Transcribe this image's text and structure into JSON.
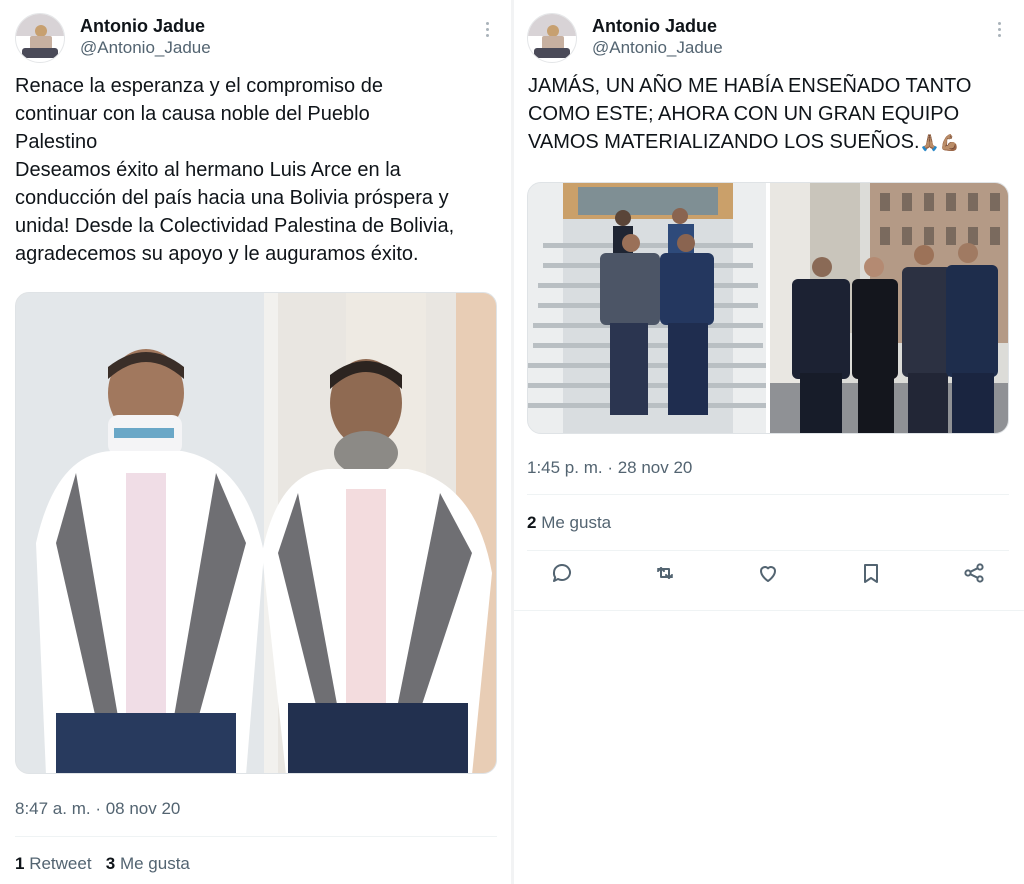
{
  "left_tweet": {
    "author_name": "Antonio Jadue",
    "author_handle": "@Antonio_Jadue",
    "text_lines": [
      "Renace la esperanza y el compromiso de",
      "continuar con la causa noble del Pueblo",
      "Palestino",
      "Deseamos éxito al hermano Luis Arce en la",
      "conducción del país hacia una Bolivia próspera y",
      "unida! Desde la Colectividad Palestina de Bolivia,",
      "agradecemos su apoyo y le auguramos éxito."
    ],
    "timestamp": "8:47 a. m. · 08 nov 20",
    "retweets_count": "1",
    "retweets_label": "Retweet",
    "likes_count": "3",
    "likes_label": "Me gusta"
  },
  "right_tweet": {
    "author_name": "Antonio Jadue",
    "author_handle": "@Antonio_Jadue",
    "text_lines": [
      "JAMÁS, UN AÑO ME HABÍA ENSEÑADO TANTO",
      "COMO ESTE;  AHORA CON UN GRAN EQUIPO",
      "VAMOS MATERIALIZANDO LOS SUEÑOS."
    ],
    "text_emoji": "🙏🏽💪🏽",
    "timestamp": "1:45 p. m. · 28 nov 20",
    "likes_count": "2",
    "likes_label": "Me gusta",
    "actions": [
      "reply-icon",
      "retweet-icon",
      "like-icon",
      "bookmark-icon",
      "share-icon"
    ]
  },
  "colors": {
    "text_primary": "#0f1419",
    "text_secondary": "#536471",
    "divider": "#eff3f4"
  }
}
